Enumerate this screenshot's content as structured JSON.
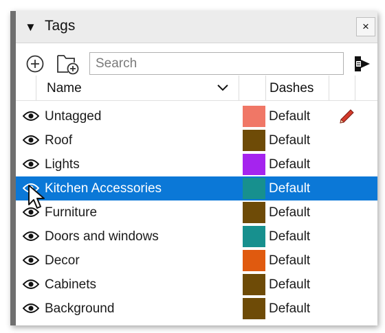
{
  "panel": {
    "title": "Tags",
    "close_label": "×"
  },
  "toolbar": {
    "add_tag_icon": "circle-plus-icon",
    "add_folder_icon": "folder-plus-icon",
    "search_placeholder": "Search",
    "search_value": "",
    "details_icon": "details-arrow-icon"
  },
  "columns": {
    "name_label": "Name",
    "dashes_label": "Dashes"
  },
  "tags": [
    {
      "name": "Untagged",
      "color": "#F07766",
      "dashes": "Default",
      "visible": true,
      "selected": false,
      "active": true
    },
    {
      "name": "Roof",
      "color": "#6E4B07",
      "dashes": "Default",
      "visible": true,
      "selected": false,
      "active": false
    },
    {
      "name": "Lights",
      "color": "#A524EE",
      "dashes": "Default",
      "visible": true,
      "selected": false,
      "active": false
    },
    {
      "name": "Kitchen Accessories",
      "color": "#17908E",
      "dashes": "Default",
      "visible": true,
      "selected": true,
      "active": false
    },
    {
      "name": "Furniture",
      "color": "#6E4B07",
      "dashes": "Default",
      "visible": true,
      "selected": false,
      "active": false
    },
    {
      "name": "Doors and windows",
      "color": "#17908E",
      "dashes": "Default",
      "visible": true,
      "selected": false,
      "active": false
    },
    {
      "name": "Decor",
      "color": "#E05A0F",
      "dashes": "Default",
      "visible": true,
      "selected": false,
      "active": false
    },
    {
      "name": "Cabinets",
      "color": "#6E4B07",
      "dashes": "Default",
      "visible": true,
      "selected": false,
      "active": false
    },
    {
      "name": "Background",
      "color": "#6E4B07",
      "dashes": "Default",
      "visible": true,
      "selected": false,
      "active": false
    }
  ],
  "colors": {
    "selection": "#0B78D7",
    "titlebar": "#ECECEC",
    "pencil_red": "#D33B2C"
  }
}
